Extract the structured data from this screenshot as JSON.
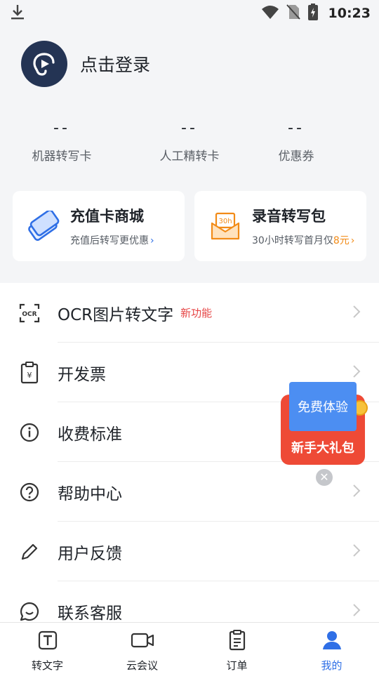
{
  "status_bar": {
    "time": "10:23"
  },
  "profile": {
    "login_text": "点击登录"
  },
  "stats": [
    {
      "value": "--",
      "label": "机器转写卡"
    },
    {
      "value": "--",
      "label": "人工精转卡"
    },
    {
      "value": "--",
      "label": "优惠券"
    }
  ],
  "cards": {
    "recharge": {
      "title": "充值卡商城",
      "subtitle": "充值后转写更优惠"
    },
    "package": {
      "title": "录音转写包",
      "subtitle_prefix": "30小时转写首月仅",
      "subtitle_highlight": "8元",
      "icon_text": "30h"
    }
  },
  "menu": [
    {
      "label": "OCR图片转文字",
      "badge": "新功能",
      "icon": "ocr-icon"
    },
    {
      "label": "开发票",
      "icon": "invoice-icon"
    },
    {
      "label": "收费标准",
      "icon": "info-icon"
    },
    {
      "label": "帮助中心",
      "icon": "help-icon"
    },
    {
      "label": "用户反馈",
      "icon": "pencil-icon"
    },
    {
      "label": "联系客服",
      "icon": "chat-icon"
    }
  ],
  "promo": {
    "ticket_text": "免费体验",
    "gift_text": "新手大礼包"
  },
  "tabs": [
    {
      "label": "转文字",
      "icon": "text-icon"
    },
    {
      "label": "云会议",
      "icon": "video-icon"
    },
    {
      "label": "订单",
      "icon": "clipboard-icon"
    },
    {
      "label": "我的",
      "icon": "user-icon",
      "active": true
    }
  ],
  "colors": {
    "accent": "#2f6fe6",
    "highlight": "#f28b17",
    "badge": "#e64545",
    "promo_red": "#ee4a36",
    "promo_blue": "#4c8ef2"
  }
}
